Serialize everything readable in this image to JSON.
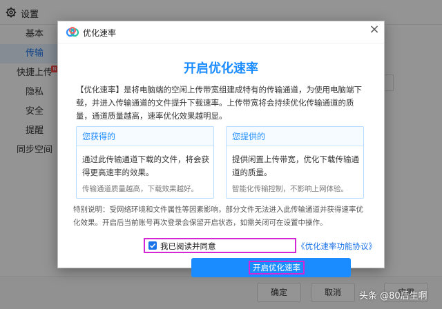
{
  "settings_window": {
    "title": "设置",
    "sidebar": {
      "items": [
        {
          "label": "基本"
        },
        {
          "label": "传输",
          "active": true
        },
        {
          "label": "快捷上传",
          "badge": "N"
        },
        {
          "label": "隐私"
        },
        {
          "label": "安全"
        },
        {
          "label": "提醒"
        },
        {
          "label": "同步空间"
        }
      ]
    },
    "footer": {
      "ok_label": "确定",
      "cancel_label": "取消",
      "apply_label": "应用"
    }
  },
  "dialog": {
    "title": "优化速率",
    "close_icon": "×",
    "heading": "开启优化速率",
    "intro": "【优化速率】是将电脑端的空闲上传带宽组建成特有的传输通道，为使用电脑端下载，并进入传输通道的文件提升下载速率。上传带宽将会持续优化传输通道的质量，通道质量越高，速率优化效果越明显。",
    "cards": [
      {
        "title": "您获得的",
        "body": "通过此传输通道下载的文件，将会获得更高速率的效果。",
        "note": "传输通道质量越高，下载效果越好。"
      },
      {
        "title": "您提供的",
        "body": "提供闲置上传带宽，优化下载传输通道的质量。",
        "note": "智能化传输控制，不影响上网体验。"
      }
    ],
    "notice": "特别说明：受网络环境和文件属性等因素影响，部分文件无法进入此传输通道并获得速率优化效果。开启后当前账号再次登录会保留开启状态，如需关闭可在设置中操作。",
    "agreement": {
      "checked": true,
      "label": "我已阅读并同意",
      "link": "《优化速率功能协议》"
    },
    "enable_button": "开启优化速率"
  },
  "watermark": "头条 @80后生啊",
  "colors": {
    "accent": "#1a8cff",
    "highlight_box": "#d426d4",
    "link": "#1a73e8"
  }
}
